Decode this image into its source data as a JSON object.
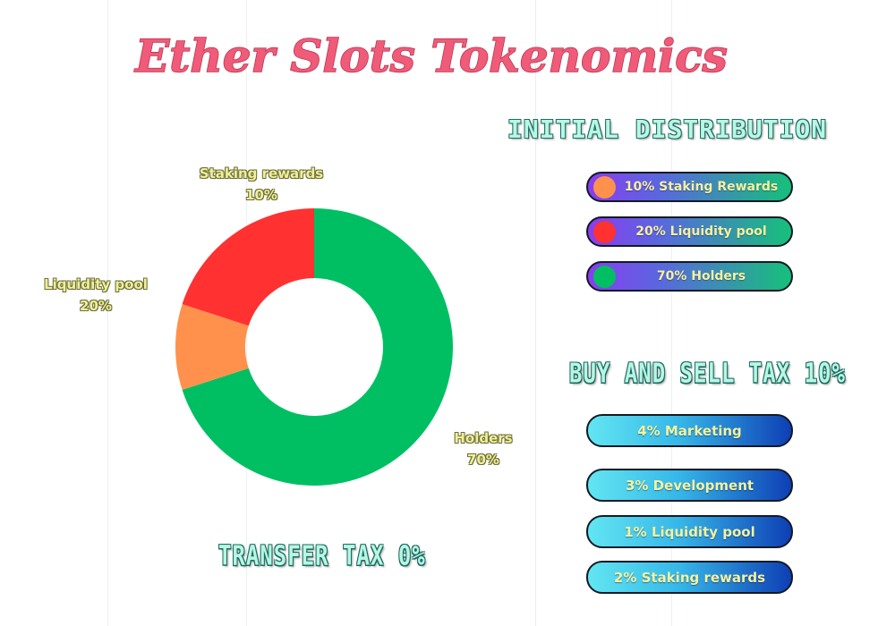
{
  "title": "Ether Slots  Tokenomics",
  "initial_distribution": {
    "heading": "INITIAL DISTRIBUTION",
    "items": [
      {
        "label": "10% Staking Rewards",
        "color": "#ff914d"
      },
      {
        "label": "20% Liquidity pool",
        "color": "#ff3131"
      },
      {
        "label": "70% Holders",
        "color": "#00bf63"
      }
    ]
  },
  "buy_sell_tax": {
    "heading": "BUY AND SELL TAX  10%",
    "items": [
      {
        "label": "4%  Marketing"
      },
      {
        "label": "3%  Development"
      },
      {
        "label": "1%  Liquidity pool"
      },
      {
        "label": "2%  Staking rewards"
      }
    ]
  },
  "transfer_tax": {
    "heading": "TRANSFER TAX 0%"
  },
  "chart_data": {
    "type": "pie",
    "style": "donut",
    "slices": [
      {
        "name": "Staking rewards",
        "value": 10,
        "label": "10%",
        "color": "#ff914d"
      },
      {
        "name": "Liquidity pool",
        "value": 20,
        "label": "20%",
        "color": "#ff3131"
      },
      {
        "name": "Holders",
        "value": 70,
        "label": "70%",
        "color": "#00bf63"
      }
    ]
  }
}
